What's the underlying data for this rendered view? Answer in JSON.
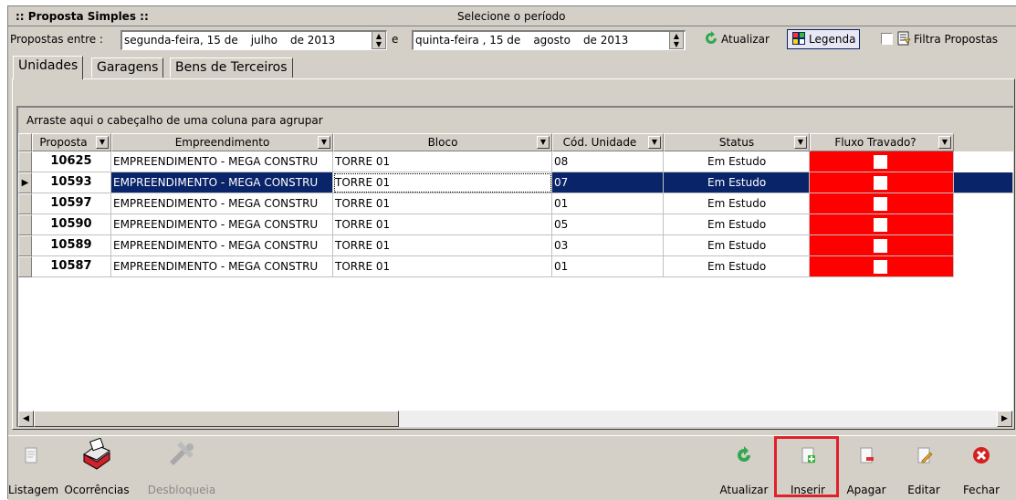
{
  "window": {
    "title": ":: Proposta Simples ::",
    "subtitle": "Selecione o período"
  },
  "period": {
    "label": "Propostas entre :",
    "conjunction": "e",
    "start": {
      "weekday": "segunda-feira, 15 de",
      "month": "julho",
      "year": "de 2013"
    },
    "end": {
      "weekday": "quinta-feira , 15 de",
      "month": "agosto",
      "year": "de 2013"
    }
  },
  "toolbar": {
    "atualizar_label": "Atualizar",
    "legenda_label": "Legenda",
    "filtra_label": "Filtra Propostas",
    "filtra_checked": false
  },
  "tabs": [
    {
      "label": "Unidades",
      "active": true
    },
    {
      "label": "Garagens",
      "active": false
    },
    {
      "label": "Bens de Terceiros",
      "active": false
    }
  ],
  "grid": {
    "group_hint": "Arraste aqui o cabeçalho de uma coluna para agrupar",
    "columns": [
      "Proposta",
      "Empreendimento",
      "Bloco",
      "Cód. Unidade",
      "Status",
      "Fluxo Travado?"
    ],
    "rows": [
      {
        "proposta": "10625",
        "empreendimento": "EMPREENDIMENTO - MEGA CONSTRU",
        "bloco": "TORRE 01",
        "unidade": "08",
        "status": "Em Estudo",
        "selected": false
      },
      {
        "proposta": "10593",
        "empreendimento": "EMPREENDIMENTO - MEGA CONSTRU",
        "bloco": "TORRE 01",
        "unidade": "07",
        "status": "Em Estudo",
        "selected": true
      },
      {
        "proposta": "10597",
        "empreendimento": "EMPREENDIMENTO - MEGA CONSTRU",
        "bloco": "TORRE 01",
        "unidade": "01",
        "status": "Em Estudo",
        "selected": false
      },
      {
        "proposta": "10590",
        "empreendimento": "EMPREENDIMENTO - MEGA CONSTRU",
        "bloco": "TORRE 01",
        "unidade": "05",
        "status": "Em Estudo",
        "selected": false
      },
      {
        "proposta": "10589",
        "empreendimento": "EMPREENDIMENTO - MEGA CONSTRU",
        "bloco": "TORRE 01",
        "unidade": "03",
        "status": "Em Estudo",
        "selected": false
      },
      {
        "proposta": "10587",
        "empreendimento": "EMPREENDIMENTO - MEGA CONSTRU",
        "bloco": "TORRE 01",
        "unidade": "01",
        "status": "Em Estudo",
        "selected": false
      }
    ]
  },
  "bottom": {
    "listagem": "Listagem",
    "ocorrencias": "Ocorrências",
    "desbloqueia": "Desbloqueia",
    "atualizar": "Atualizar",
    "inserir": "Inserir",
    "apagar": "Apagar",
    "editar": "Editar",
    "fechar": "Fechar"
  },
  "colors": {
    "selection": "#0a246a",
    "fluxo_travado": "#ff0000",
    "highlight": "#e0202a"
  }
}
